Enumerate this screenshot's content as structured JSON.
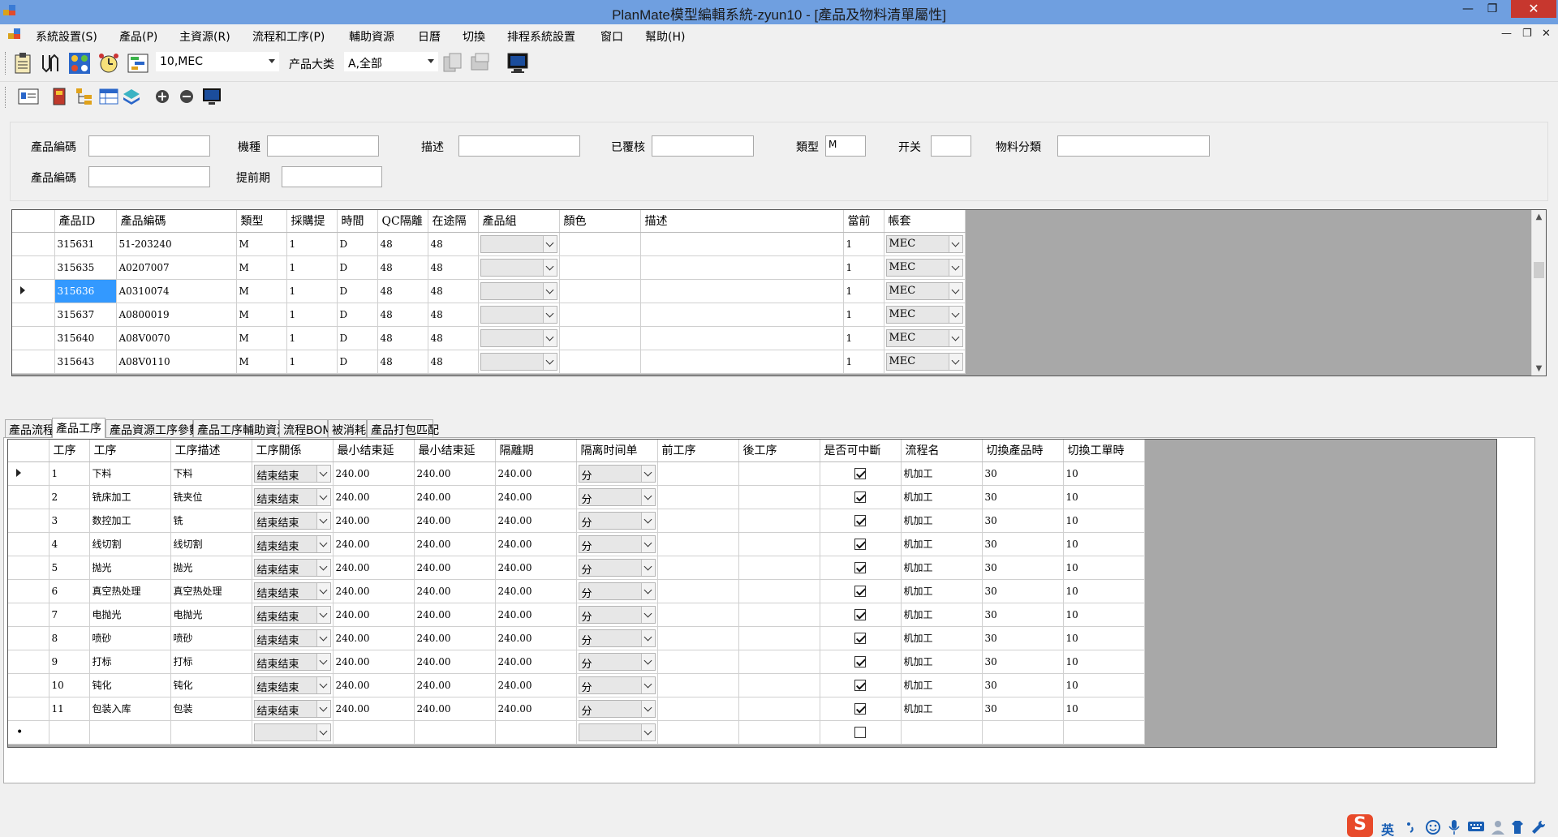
{
  "window": {
    "title": "PlanMate模型編輯系統-zyun10 - [產品及物料清單屬性]",
    "minimize": "—",
    "maximize": "❐",
    "close": "✕"
  },
  "menu": {
    "items": [
      "系統設置(S)",
      "產品(P)",
      "主資源(R)",
      "流程和工序(P)",
      "輔助資源",
      "日曆",
      "切換",
      "排程系統設置",
      "窗口",
      "幫助(H)"
    ],
    "mdi_min": "—",
    "mdi_restore": "❐",
    "mdi_close": "✕"
  },
  "toolbar1": {
    "combo1_value": "10,MEC",
    "label": "产品大类",
    "combo2_value": "A,全部"
  },
  "filters": {
    "product_code_label": "產品編碼",
    "model_label": "機種",
    "desc_label": "描述",
    "reviewed_label": "已覆核",
    "type_label": "類型",
    "type_value": "M",
    "switch_label": "开关",
    "material_class_label": "物料分類",
    "product_code2_label": "產品編碼",
    "lead_label": "提前期"
  },
  "products": {
    "columns": [
      "產品ID",
      "產品編碼",
      "類型",
      "採購提",
      "時間",
      "QC隔離",
      "在途隔",
      "產品組",
      "顏色",
      "描述",
      "當前",
      "帳套"
    ],
    "rows": [
      {
        "id": "315631",
        "code": "51-203240",
        "type": "M",
        "p1": "1",
        "time": "D",
        "qc": "48",
        "transit": "48",
        "current": "1",
        "account": "MEC"
      },
      {
        "id": "315635",
        "code": "A0207007",
        "type": "M",
        "p1": "1",
        "time": "D",
        "qc": "48",
        "transit": "48",
        "current": "1",
        "account": "MEC"
      },
      {
        "id": "315636",
        "code": "A0310074",
        "type": "M",
        "p1": "1",
        "time": "D",
        "qc": "48",
        "transit": "48",
        "current": "1",
        "account": "MEC"
      },
      {
        "id": "315637",
        "code": "A0800019",
        "type": "M",
        "p1": "1",
        "time": "D",
        "qc": "48",
        "transit": "48",
        "current": "1",
        "account": "MEC"
      },
      {
        "id": "315640",
        "code": "A08V0070",
        "type": "M",
        "p1": "1",
        "time": "D",
        "qc": "48",
        "transit": "48",
        "current": "1",
        "account": "MEC"
      },
      {
        "id": "315643",
        "code": "A08V0110",
        "type": "M",
        "p1": "1",
        "time": "D",
        "qc": "48",
        "transit": "48",
        "current": "1",
        "account": "MEC"
      }
    ],
    "selected_row": 2
  },
  "tabs": [
    "產品流程",
    "產品工序",
    "產品資源工序參數",
    "產品工序輔助資源",
    "流程BOM",
    "被消耗",
    "產品打包匹配"
  ],
  "active_tab": 1,
  "operations": {
    "columns": [
      "工序",
      "工序",
      "工序描述",
      "工序關係",
      "最小结束延",
      "最小结束延",
      "隔離期",
      "隔离时间单",
      "前工序",
      "後工序",
      "是否可中斷",
      "流程名",
      "切換產品時",
      "切換工單時"
    ],
    "rows": [
      {
        "seq": "1",
        "op": "下料",
        "desc": "下料",
        "rel": "结束结束",
        "min1": "240.00",
        "min2": "240.00",
        "iso": "240.00",
        "unit": "分",
        "interrupt": true,
        "flow": "机加工",
        "sw1": "30",
        "sw2": "10"
      },
      {
        "seq": "2",
        "op": "铣床加工",
        "desc": "铣夹位",
        "rel": "结束结束",
        "min1": "240.00",
        "min2": "240.00",
        "iso": "240.00",
        "unit": "分",
        "interrupt": true,
        "flow": "机加工",
        "sw1": "30",
        "sw2": "10"
      },
      {
        "seq": "3",
        "op": "数控加工",
        "desc": "铣",
        "rel": "结束结束",
        "min1": "240.00",
        "min2": "240.00",
        "iso": "240.00",
        "unit": "分",
        "interrupt": true,
        "flow": "机加工",
        "sw1": "30",
        "sw2": "10"
      },
      {
        "seq": "4",
        "op": "线切割",
        "desc": "线切割",
        "rel": "结束结束",
        "min1": "240.00",
        "min2": "240.00",
        "iso": "240.00",
        "unit": "分",
        "interrupt": true,
        "flow": "机加工",
        "sw1": "30",
        "sw2": "10"
      },
      {
        "seq": "5",
        "op": "抛光",
        "desc": "抛光",
        "rel": "结束结束",
        "min1": "240.00",
        "min2": "240.00",
        "iso": "240.00",
        "unit": "分",
        "interrupt": true,
        "flow": "机加工",
        "sw1": "30",
        "sw2": "10"
      },
      {
        "seq": "6",
        "op": "真空热处理",
        "desc": "真空热处理",
        "rel": "结束结束",
        "min1": "240.00",
        "min2": "240.00",
        "iso": "240.00",
        "unit": "分",
        "interrupt": true,
        "flow": "机加工",
        "sw1": "30",
        "sw2": "10"
      },
      {
        "seq": "7",
        "op": "电抛光",
        "desc": "电抛光",
        "rel": "结束结束",
        "min1": "240.00",
        "min2": "240.00",
        "iso": "240.00",
        "unit": "分",
        "interrupt": true,
        "flow": "机加工",
        "sw1": "30",
        "sw2": "10"
      },
      {
        "seq": "8",
        "op": "喷砂",
        "desc": "喷砂",
        "rel": "结束结束",
        "min1": "240.00",
        "min2": "240.00",
        "iso": "240.00",
        "unit": "分",
        "interrupt": true,
        "flow": "机加工",
        "sw1": "30",
        "sw2": "10"
      },
      {
        "seq": "9",
        "op": "打标",
        "desc": "打标",
        "rel": "结束结束",
        "min1": "240.00",
        "min2": "240.00",
        "iso": "240.00",
        "unit": "分",
        "interrupt": true,
        "flow": "机加工",
        "sw1": "30",
        "sw2": "10"
      },
      {
        "seq": "10",
        "op": "钝化",
        "desc": "钝化",
        "rel": "结束结束",
        "min1": "240.00",
        "min2": "240.00",
        "iso": "240.00",
        "unit": "分",
        "interrupt": true,
        "flow": "机加工",
        "sw1": "30",
        "sw2": "10"
      },
      {
        "seq": "11",
        "op": "包装入库",
        "desc": "包装",
        "rel": "结束结束",
        "min1": "240.00",
        "min2": "240.00",
        "iso": "240.00",
        "unit": "分",
        "interrupt": true,
        "flow": "机加工",
        "sw1": "30",
        "sw2": "10"
      }
    ],
    "new_row_mark": "•"
  },
  "ime": {
    "logo": "S",
    "lang": "英"
  }
}
